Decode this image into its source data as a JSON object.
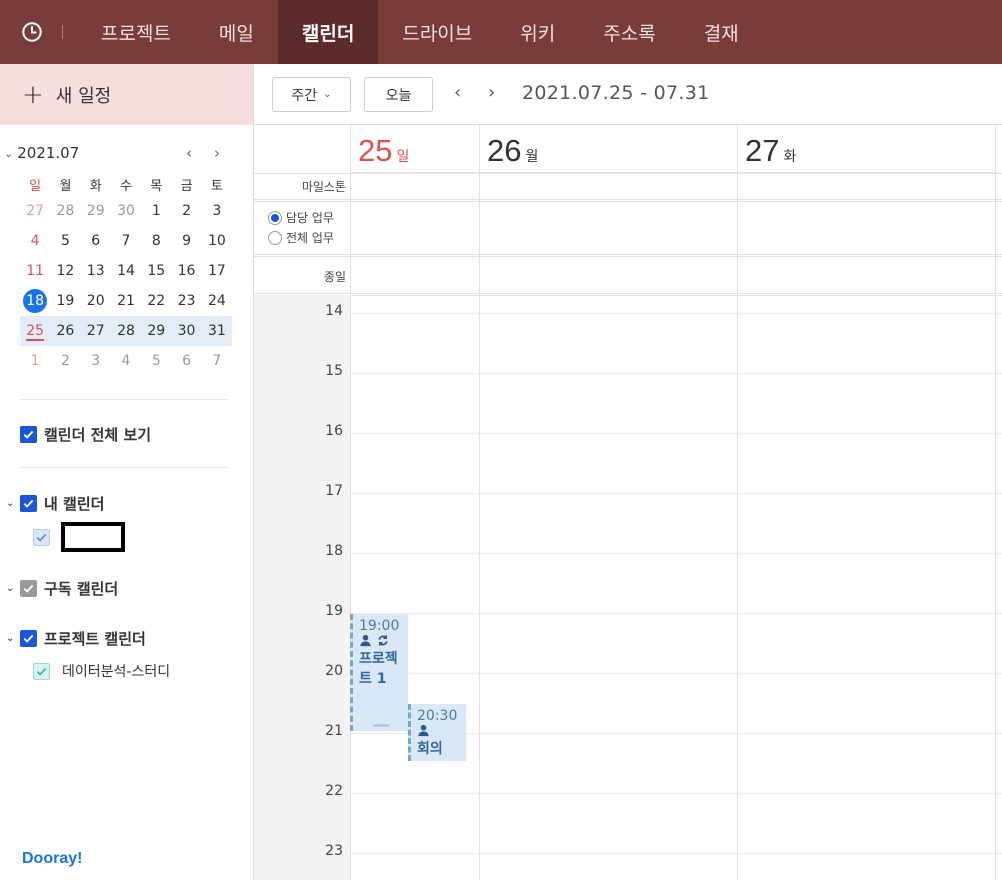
{
  "nav": {
    "items": [
      {
        "label": "프로젝트",
        "active": false
      },
      {
        "label": "메일",
        "active": false
      },
      {
        "label": "캘린더",
        "active": true
      },
      {
        "label": "드라이브",
        "active": false
      },
      {
        "label": "위키",
        "active": false
      },
      {
        "label": "주소록",
        "active": false
      },
      {
        "label": "결재",
        "active": false
      }
    ]
  },
  "sidebar": {
    "new_event": "새 일정",
    "mini_month": "2021.07",
    "dow": [
      "일",
      "월",
      "화",
      "수",
      "목",
      "금",
      "토"
    ],
    "weeks": [
      [
        "27",
        "28",
        "29",
        "30",
        "1",
        "2",
        "3"
      ],
      [
        "4",
        "5",
        "6",
        "7",
        "8",
        "9",
        "10"
      ],
      [
        "11",
        "12",
        "13",
        "14",
        "15",
        "16",
        "17"
      ],
      [
        "18",
        "19",
        "20",
        "21",
        "22",
        "23",
        "24"
      ],
      [
        "25",
        "26",
        "27",
        "28",
        "29",
        "30",
        "31"
      ],
      [
        "1",
        "2",
        "3",
        "4",
        "5",
        "6",
        "7"
      ]
    ],
    "view_all": "캘린더 전체 보기",
    "my_calendar": "내 캘린더",
    "subscribed": "구독 캘린더",
    "project_calendar": "프로젝트 캘린더",
    "project_item": "데이터분석-스터디",
    "logo": "Dooray!"
  },
  "toolbar": {
    "view": "주간",
    "today": "오늘",
    "prev": "‹",
    "next": "›",
    "range": "2021.07.25 - 07.31"
  },
  "calendar": {
    "days": [
      {
        "num": "25",
        "dow": "일"
      },
      {
        "num": "26",
        "dow": "월"
      },
      {
        "num": "27",
        "dow": "화"
      }
    ],
    "milestone": "마일스톤",
    "task_mine": "담당 업무",
    "task_all": "전체 업무",
    "allday": "종일",
    "hours": [
      "14",
      "15",
      "16",
      "17",
      "18",
      "19",
      "20",
      "21",
      "22",
      "23"
    ],
    "events": [
      {
        "time": "19:00",
        "title": "프로젝트 1"
      },
      {
        "time": "20:30",
        "title": "회의"
      }
    ]
  },
  "colors": {
    "nav_bg": "#7a3b3b",
    "nav_active": "#5c2a2a",
    "accent": "#1a73e8",
    "sunday": "#d9534f"
  }
}
